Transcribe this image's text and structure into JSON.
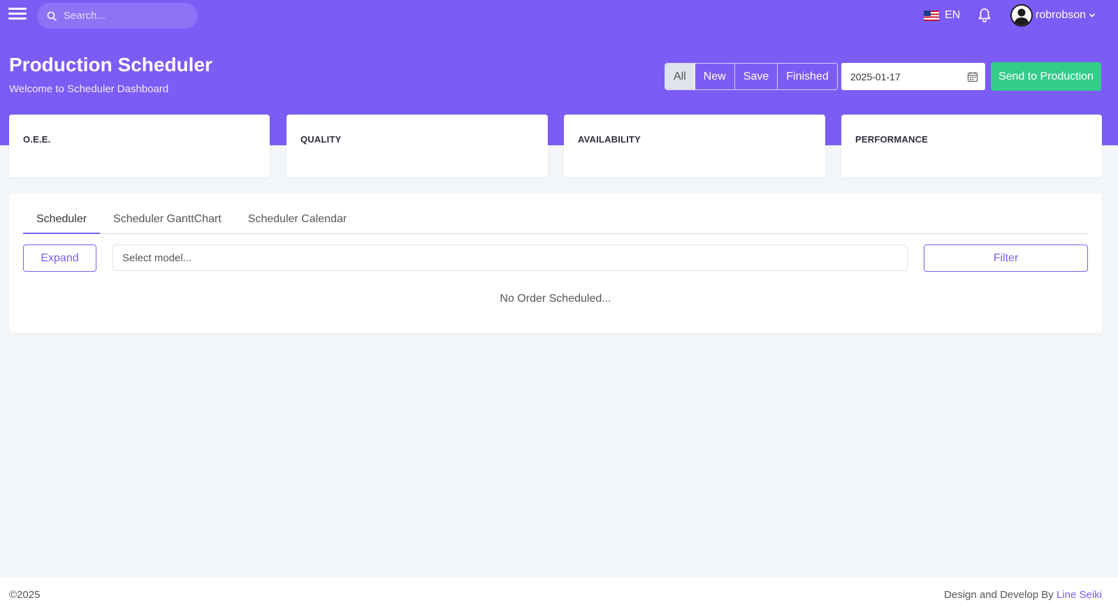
{
  "header": {
    "search_placeholder": "Search...",
    "language": "EN",
    "username": "robrobson"
  },
  "hero": {
    "title": "Production Scheduler",
    "subtitle": "Welcome to Scheduler Dashboard",
    "status_filters": [
      "All",
      "New",
      "Save",
      "Finished"
    ],
    "active_filter": "All",
    "date": "2025-01-17",
    "send_label": "Send to Production"
  },
  "kpis": [
    {
      "label": "O.E.E."
    },
    {
      "label": "QUALITY"
    },
    {
      "label": "AVAILABILITY"
    },
    {
      "label": "PERFORMANCE"
    }
  ],
  "panel": {
    "tabs": [
      "Scheduler",
      "Scheduler GanttChart",
      "Scheduler Calendar"
    ],
    "active_tab": "Scheduler",
    "expand_label": "Expand",
    "model_placeholder": "Select model...",
    "filter_label": "Filter",
    "empty_message": "No Order Scheduled..."
  },
  "footer": {
    "copyright": "©2025",
    "credit_prefix": "Design and Develop By",
    "credit_link": "Line Seiki"
  },
  "colors": {
    "brand": "#7b5cf5",
    "success": "#33cc8a",
    "background": "#f3f6f8"
  }
}
